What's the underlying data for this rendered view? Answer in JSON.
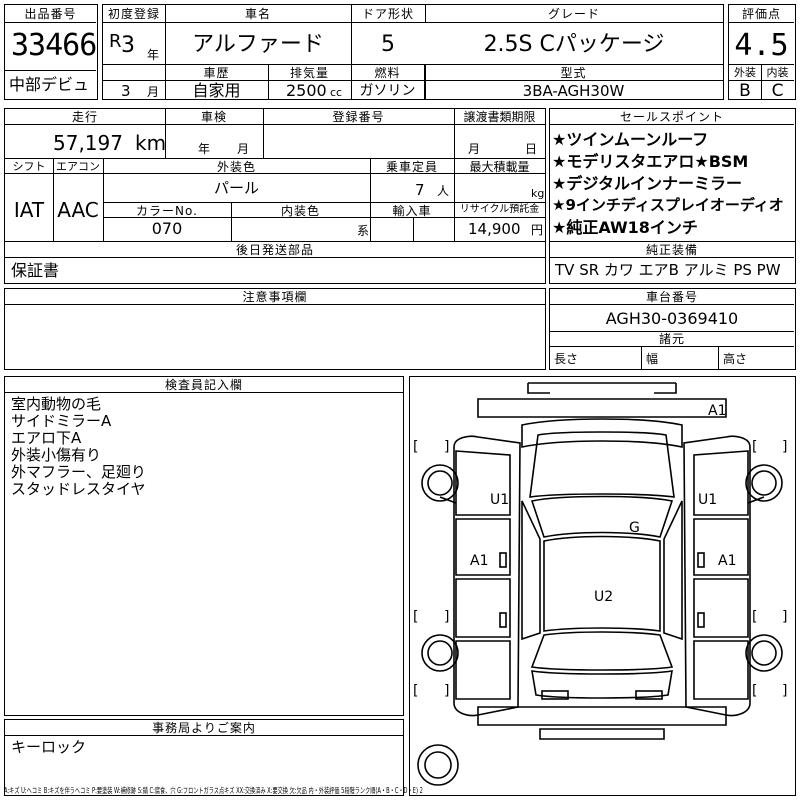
{
  "lot": {
    "label": "出品番号",
    "number": "33466",
    "event": "中部デビュ"
  },
  "first_reg": {
    "label": "初度登録",
    "era": "R",
    "year": "3",
    "year_unit": "年",
    "month": "3",
    "month_unit": "月"
  },
  "car_name": {
    "label": "車名",
    "value": "アルファード"
  },
  "doors": {
    "label": "ドア形状",
    "value": "5"
  },
  "grade": {
    "label": "グレード",
    "value": "2.5S Cパッケージ"
  },
  "score": {
    "label": "評価点",
    "value": "4.5",
    "ext_label": "外装",
    "int_label": "内装",
    "ext": "B",
    "int": "C"
  },
  "history": {
    "label": "車歴",
    "value": "自家用"
  },
  "displacement": {
    "label": "排気量",
    "value": "2500",
    "unit": "cc"
  },
  "fuel": {
    "label": "燃料",
    "value": "ガソリン"
  },
  "model": {
    "label": "型式",
    "value": "3BA-AGH30W"
  },
  "mileage": {
    "label": "走行",
    "value": "57,197",
    "unit": "km"
  },
  "inspection": {
    "label": "車検",
    "year_unit": "年",
    "month_unit": "月"
  },
  "reg_no": {
    "label": "登録番号"
  },
  "transfer": {
    "label": "譲渡書類期限",
    "month_unit": "月",
    "day_unit": "日"
  },
  "shift": {
    "label": "シフト",
    "value": "IAT"
  },
  "aircon": {
    "label": "エアコン",
    "value": "AAC"
  },
  "ext_color": {
    "label": "外装色",
    "value": "パール"
  },
  "capacity": {
    "label": "乗車定員",
    "value": "7",
    "unit": "人"
  },
  "load": {
    "label": "最大積載量",
    "unit": "kg"
  },
  "color_no": {
    "label": "カラーNo.",
    "value": "070"
  },
  "int_color": {
    "label": "内装色",
    "unit": "系"
  },
  "import": {
    "label": "輸入車"
  },
  "recycle": {
    "label": "リサイクル預託金",
    "value": "14,900",
    "unit": "円"
  },
  "sales_points": {
    "label": "セールスポイント",
    "items": [
      "★ツインムーンルーフ",
      "★モデリスタエアロ★BSM",
      "★デジタルインナーミラー",
      "★9インチディスプレイオーディオ",
      "★純正AW18インチ"
    ]
  },
  "later_parts": {
    "label": "後日発送部品",
    "value": "保証書"
  },
  "equipment": {
    "label": "純正装備",
    "value": "TV SR カワ エアB アルミ PS PW"
  },
  "notes": {
    "label": "注意事項欄"
  },
  "chassis": {
    "label": "車台番号",
    "value": "AGH30-0369410"
  },
  "dims": {
    "label": "諸元",
    "length": "長さ",
    "width": "幅",
    "height": "高さ"
  },
  "inspector": {
    "label": "検査員記入欄",
    "lines": [
      "室内動物の毛",
      "サイドミラーA",
      "エアロ下A",
      "外装小傷有り",
      "外マフラー、足廻り",
      "スタッドレスタイヤ"
    ]
  },
  "office": {
    "label": "事務局よりご案内",
    "value": "キーロック"
  },
  "diagram": {
    "marks": {
      "front_right": "A1",
      "upper_left": "U1",
      "upper_right": "U1",
      "roof": "G",
      "left_door": "A1",
      "right_door": "A1",
      "rear": "U2"
    },
    "bracket_open": "[",
    "bracket_close": "]"
  },
  "legend": "A:キズ U:ヘコミ B:キズを伴うヘコミ P:要塗装 W:補修跡 S:錆 C:腐食、穴 G:フロントガラス点キズ XX:交換済み X:要交換 欠:欠品 内・外装評価 5段階ランク順(A・B・C・D・E) 2"
}
